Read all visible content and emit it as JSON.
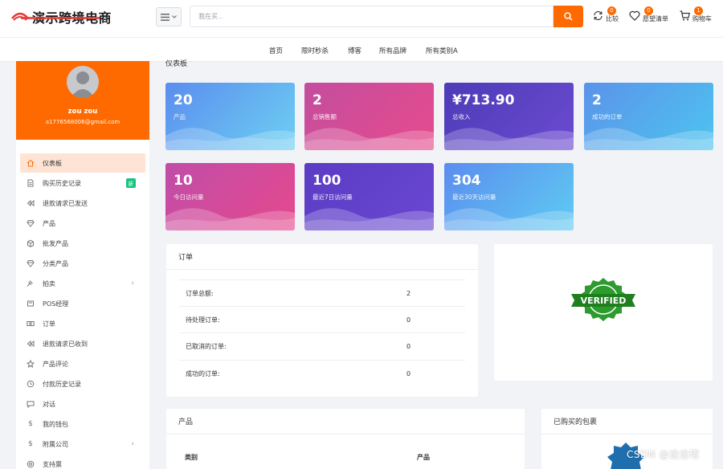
{
  "header": {
    "logo_text": "演示跨境电商",
    "menu_icon": "hamburger-icon",
    "search_placeholder": "我在买...",
    "actions": [
      {
        "label": "比较",
        "count": "0",
        "icon": "refresh-icon"
      },
      {
        "label": "愿望清单",
        "count": "0",
        "icon": "heart-icon"
      },
      {
        "label": "购物车",
        "count": "1",
        "icon": "cart-icon"
      }
    ]
  },
  "nav": [
    "首页",
    "限时秒杀",
    "博客",
    "所有品牌",
    "所有类别A"
  ],
  "profile": {
    "name": "zou zou",
    "email": "a1776568006@gmail.com"
  },
  "sidebar": {
    "items": [
      {
        "label": "仪表板",
        "icon": "home-icon"
      },
      {
        "label": "购买历史记录",
        "icon": "document-icon",
        "badge": "新"
      },
      {
        "label": "退款请求已发送",
        "icon": "rewind-icon"
      },
      {
        "label": "产品",
        "icon": "gem-icon"
      },
      {
        "label": "批发产品",
        "icon": "box-icon"
      },
      {
        "label": "分类产品",
        "icon": "gem-icon"
      },
      {
        "label": "拍卖",
        "icon": "gavel-icon",
        "chevron": true
      },
      {
        "label": "POS经理",
        "icon": "pos-icon"
      },
      {
        "label": "订单",
        "icon": "money-icon"
      },
      {
        "label": "退款请求已收到",
        "icon": "rewind-icon"
      },
      {
        "label": "产品评论",
        "icon": "star-icon"
      },
      {
        "label": "付款历史记录",
        "icon": "history-icon"
      },
      {
        "label": "对话",
        "icon": "chat-icon"
      },
      {
        "label": "我的钱包",
        "icon": "dollar-icon"
      },
      {
        "label": "附属公司",
        "icon": "dollar-icon",
        "chevron": true
      },
      {
        "label": "支持票",
        "icon": "support-icon"
      }
    ]
  },
  "dashboard_title": "仪表板",
  "cards": [
    {
      "value": "20",
      "label": "产品",
      "c1": "#5b8def",
      "c2": "#6dd0f2"
    },
    {
      "value": "2",
      "label": "总销售额",
      "c1": "#c34d9e",
      "c2": "#e74c8d"
    },
    {
      "value": "¥713.90",
      "label": "总收入",
      "c1": "#4d3bb7",
      "c2": "#6b4bd1"
    },
    {
      "value": "2",
      "label": "成功的订单",
      "c1": "#5b93ea",
      "c2": "#4ec4ef"
    },
    {
      "value": "10",
      "label": "今日访问量",
      "c1": "#c04da8",
      "c2": "#e6498d"
    },
    {
      "value": "100",
      "label": "最近7日访问量",
      "c1": "#5b3cc4",
      "c2": "#6a47d2"
    },
    {
      "value": "304",
      "label": "最近30天访问量",
      "c1": "#5b8def",
      "c2": "#5fcbf2"
    }
  ],
  "orders": {
    "title": "订单",
    "rows": [
      {
        "label": "订单总额:",
        "value": "2"
      },
      {
        "label": "待处理订单:",
        "value": "0"
      },
      {
        "label": "已取消的订单:",
        "value": "0"
      },
      {
        "label": "成功的订单:",
        "value": "0"
      }
    ]
  },
  "verified": {
    "text": "VERIFIED",
    "color": "#1f8a1f"
  },
  "products": {
    "title": "产品",
    "col1": "类别",
    "col2": "产品"
  },
  "packages": {
    "title": "已购买的包裹"
  },
  "watermark": "CSDN @途途珺"
}
